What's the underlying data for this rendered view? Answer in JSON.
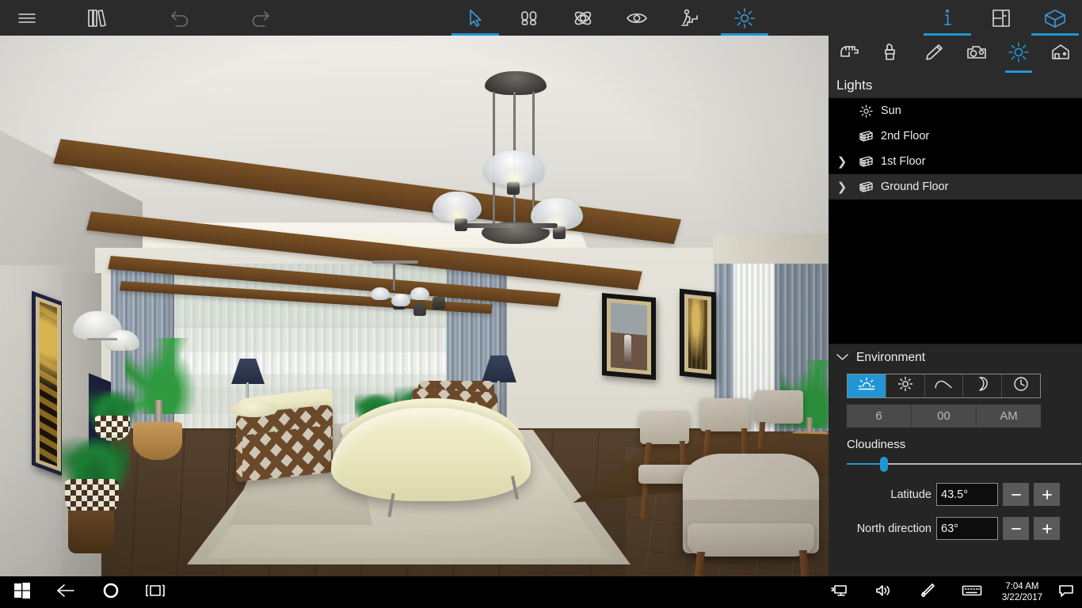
{
  "app": {
    "topbar": {
      "left_buttons": [
        {
          "name": "hamburger-menu",
          "icon": "hamburger-icon",
          "state": "normal"
        },
        {
          "name": "catalog",
          "icon": "books-icon",
          "state": "normal"
        },
        {
          "name": "undo",
          "icon": "undo-arrow-icon",
          "state": "disabled"
        },
        {
          "name": "redo",
          "icon": "redo-arrow-icon",
          "state": "disabled"
        }
      ],
      "center_buttons": [
        {
          "name": "select-tool",
          "icon": "cursor-arrow-icon",
          "state": "active"
        },
        {
          "name": "walk-tool",
          "icon": "footprints-icon",
          "state": "normal"
        },
        {
          "name": "orbit-tool",
          "icon": "orbit-atom-icon",
          "state": "normal"
        },
        {
          "name": "visibility-tool",
          "icon": "eye-icon",
          "state": "normal"
        },
        {
          "name": "stairs-tool",
          "icon": "person-stairs-icon",
          "state": "normal"
        },
        {
          "name": "lighting-tool",
          "icon": "sun-icon",
          "state": "active-accent"
        }
      ],
      "right_buttons": [
        {
          "name": "info",
          "icon": "info-i-icon",
          "state": "active-accent"
        },
        {
          "name": "floorplan-view",
          "icon": "floorplan-icon",
          "state": "normal"
        },
        {
          "name": "3d-view",
          "icon": "cube-house-icon",
          "state": "active-accent"
        }
      ]
    },
    "viewport": {
      "expand_left_handle": "❯",
      "scene_description": "3D rendered living room with dining area"
    },
    "right_panel": {
      "tabs": [
        {
          "name": "tab-furniture",
          "icon": "hand-furniture-icon",
          "active": false
        },
        {
          "name": "tab-materials",
          "icon": "paint-brush-icon",
          "active": false
        },
        {
          "name": "tab-draw",
          "icon": "pencil-icon",
          "active": false
        },
        {
          "name": "tab-camera",
          "icon": "camera-icon",
          "active": false
        },
        {
          "name": "tab-lighting",
          "icon": "sun-icon",
          "active": true
        },
        {
          "name": "tab-building",
          "icon": "house-icon",
          "active": false
        }
      ],
      "lights": {
        "title": "Lights",
        "items": [
          {
            "label": "Sun",
            "icon": "sun-icon",
            "expandable": false,
            "selected": false
          },
          {
            "label": "2nd Floor",
            "icon": "floor-slab-icon",
            "expandable": false,
            "selected": false
          },
          {
            "label": "1st Floor",
            "icon": "floor-slab-icon",
            "expandable": true,
            "selected": false
          },
          {
            "label": "Ground Floor",
            "icon": "floor-slab-icon",
            "expandable": true,
            "selected": true
          }
        ],
        "chevron": "❯"
      },
      "environment": {
        "title": "Environment",
        "collapse_chevron": "∨",
        "presets": [
          {
            "name": "preset-sunrise",
            "icon": "sunrise-icon",
            "active": true
          },
          {
            "name": "preset-noon",
            "icon": "sun-icon",
            "active": false
          },
          {
            "name": "preset-overcast",
            "icon": "cloud-icon",
            "active": false
          },
          {
            "name": "preset-night",
            "icon": "moon-icon",
            "active": false
          },
          {
            "name": "preset-custom-time",
            "icon": "clock-icon",
            "active": false
          }
        ],
        "time": {
          "hour": "6",
          "minute": "00",
          "meridiem": "AM"
        },
        "cloudiness": {
          "label": "Cloudiness",
          "value_percent": 16
        },
        "latitude": {
          "label": "Latitude",
          "value": "43.5°",
          "minus": "−",
          "plus": "+"
        },
        "north_direction": {
          "label": "North direction",
          "value": "63°",
          "minus": "−",
          "plus": "+"
        }
      }
    },
    "taskbar": {
      "left_buttons": [
        {
          "name": "start-button",
          "icon": "windows-logo-icon"
        },
        {
          "name": "back-button",
          "icon": "back-arrow-icon"
        },
        {
          "name": "cortana-button",
          "icon": "cortana-circle-icon"
        },
        {
          "name": "task-view-button",
          "icon": "task-view-icon"
        }
      ],
      "tray_icons": [
        {
          "name": "network-tray-icon",
          "icon": "monitor-network-icon"
        },
        {
          "name": "volume-tray-icon",
          "icon": "speaker-icon"
        },
        {
          "name": "pen-tray-icon",
          "icon": "pen-workspace-icon"
        },
        {
          "name": "keyboard-tray-icon",
          "icon": "keyboard-icon"
        }
      ],
      "clock": {
        "time": "7:04 AM",
        "date": "3/22/2017"
      },
      "action_center": {
        "name": "action-center-icon",
        "icon": "speech-bubble-icon"
      }
    },
    "colors": {
      "accent": "#2196d3",
      "panel_bg": "#252525",
      "toolbar_bg": "#2b2b2b",
      "list_bg": "#000000",
      "taskbar_bg": "#000000"
    }
  }
}
